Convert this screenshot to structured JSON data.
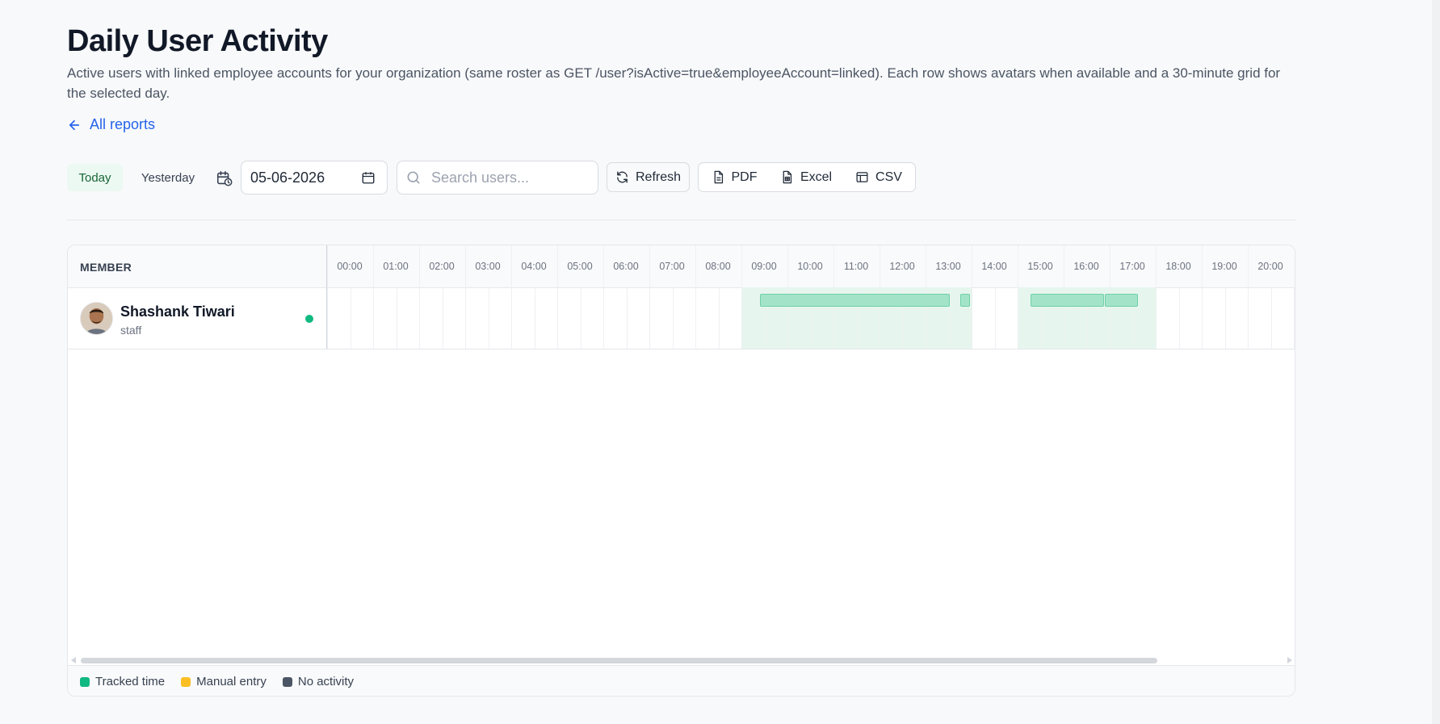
{
  "page": {
    "title": "Daily User Activity",
    "description": "Active users with linked employee accounts for your organization (same roster as GET /user?isActive=true&employeeAccount=linked). Each row shows avatars when available and a 30-minute grid for the selected day.",
    "back_link": "All reports"
  },
  "toolbar": {
    "today_label": "Today",
    "yesterday_label": "Yesterday",
    "date_value": "05-06-2026",
    "search_placeholder": "Search users...",
    "refresh_label": "Refresh",
    "pdf_label": "PDF",
    "excel_label": "Excel",
    "csv_label": "CSV"
  },
  "table": {
    "member_header": "MEMBER",
    "hours": [
      "00:00",
      "01:00",
      "02:00",
      "03:00",
      "04:00",
      "05:00",
      "06:00",
      "07:00",
      "08:00",
      "09:00",
      "10:00",
      "11:00",
      "12:00",
      "13:00",
      "14:00",
      "15:00",
      "16:00",
      "17:00",
      "18:00",
      "19:00",
      "20:00"
    ],
    "rows": [
      {
        "name": "Shashank Tiwari",
        "role": "staff",
        "status": "online",
        "active_bands_hours": [
          [
            9.0,
            14.0
          ],
          [
            15.0,
            18.0
          ]
        ],
        "tracked_segments_hours": [
          [
            9.4,
            13.53
          ],
          [
            13.76,
            13.96
          ],
          [
            15.28,
            16.87
          ],
          [
            16.9,
            17.62
          ]
        ]
      }
    ]
  },
  "legend": {
    "tracked_label": "Tracked time",
    "manual_label": "Manual entry",
    "none_label": "No activity"
  },
  "colors": {
    "tracked": "#10b981",
    "manual": "#fbbf24",
    "none": "#4b5563",
    "accent_link": "#2563eb"
  }
}
